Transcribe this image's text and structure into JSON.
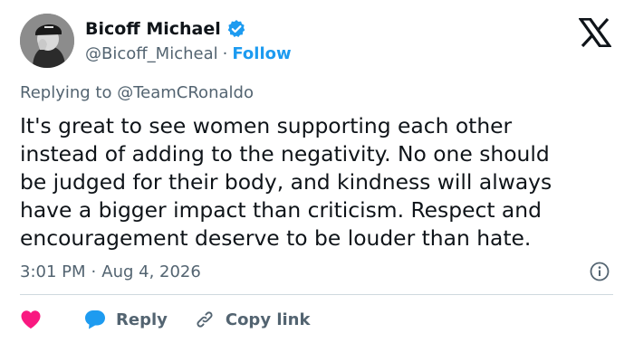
{
  "user": {
    "display_name": "Bicoff Michael",
    "handle": "@Bicoff_Micheal",
    "separator": "·",
    "follow_label": "Follow"
  },
  "reply_context": {
    "prefix": "Replying to",
    "mention": "@TeamCRonaldo"
  },
  "tweet": {
    "text_lines": [
      "It's great to see women supporting each other",
      "instead of adding to the negativity. No one should",
      "be judged for their body, and kindness will always",
      "have a bigger impact than criticism. Respect and",
      "encouragement deserve to be louder than hate."
    ],
    "time": "3:01 PM",
    "separator": "·",
    "date": "Aug 4, 2026"
  },
  "actions": {
    "reply_label": "Reply",
    "copy_link_label": "Copy link"
  },
  "colors": {
    "accent": "#1d9bf0",
    "muted": "#536471",
    "text": "#0f1419",
    "like": "#f91880",
    "divider": "#cfd9de"
  },
  "icons": [
    "verified-badge-icon",
    "x-logo-icon",
    "info-icon",
    "heart-icon",
    "reply-bubble-icon",
    "link-icon"
  ]
}
